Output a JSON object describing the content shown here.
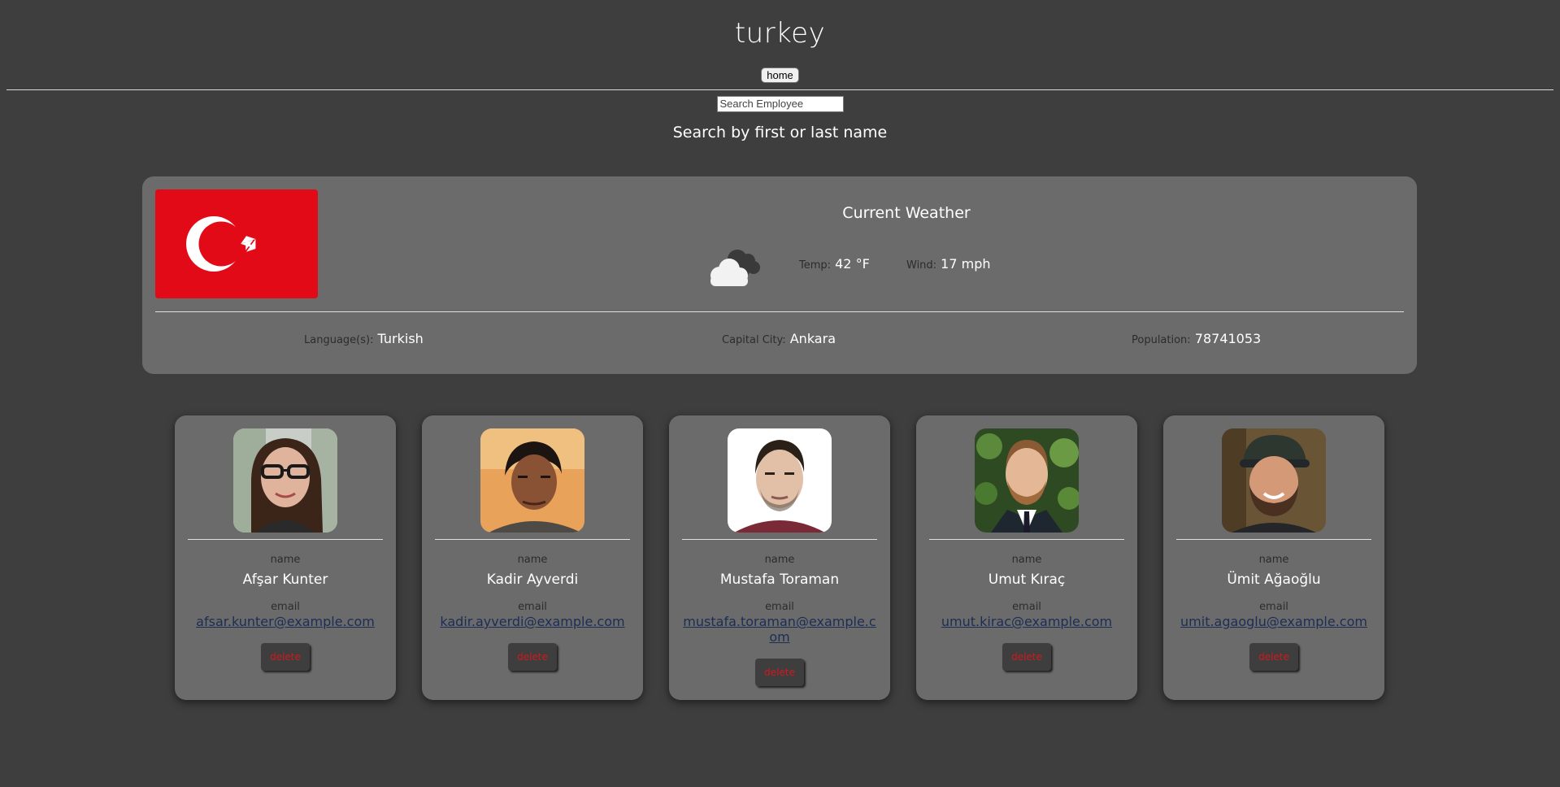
{
  "header": {
    "title": "turkey",
    "home_label": "home"
  },
  "search": {
    "placeholder": "Search Employee",
    "hint": "Search by first or last name"
  },
  "country": {
    "flag": "turkey-flag",
    "weather_title": "Current Weather",
    "weather_icon": "cloud-icon",
    "temp_label": "Temp:",
    "temp_value": "42 °F",
    "wind_label": "Wind:",
    "wind_value": "17 mph",
    "language_label": "Language(s):",
    "language_value": "Turkish",
    "capital_label": "Capital City:",
    "capital_value": "Ankara",
    "population_label": "Population:",
    "population_value": "78741053",
    "colors": {
      "flag_red": "#e30a17",
      "card_bg": "#6b6b6b",
      "page_bg": "#3e3e3e"
    }
  },
  "employees": [
    {
      "name_label": "name",
      "name": "Afşar Kunter",
      "email_label": "email",
      "email": "afsar.kunter@example.com",
      "delete_label": "delete"
    },
    {
      "name_label": "name",
      "name": "Kadir Ayverdi",
      "email_label": "email",
      "email": "kadir.ayverdi@example.com",
      "delete_label": "delete"
    },
    {
      "name_label": "name",
      "name": "Mustafa Toraman",
      "email_label": "email",
      "email": "mustafa.toraman@example.com",
      "delete_label": "delete"
    },
    {
      "name_label": "name",
      "name": "Umut Kıraç",
      "email_label": "email",
      "email": "umut.kirac@example.com",
      "delete_label": "delete"
    },
    {
      "name_label": "name",
      "name": "Ümit Ağaoğlu",
      "email_label": "email",
      "email": "umit.agaoglu@example.com",
      "delete_label": "delete"
    }
  ]
}
